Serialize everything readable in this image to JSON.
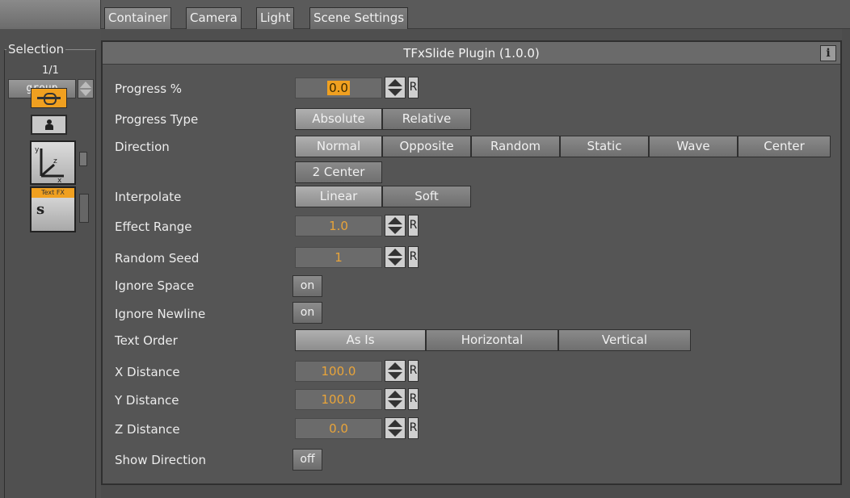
{
  "tabs": [
    "Container",
    "Camera",
    "Light",
    "Scene Settings"
  ],
  "selection": {
    "label": "Selection",
    "count": "1/1",
    "group_value": "group",
    "text_fx_badge": "Text FX",
    "text_fx_glyph": "s"
  },
  "icons": {
    "link": "link-icon",
    "person": "person-icon",
    "axis": "axis-transform-icon",
    "textfx": "text-fx-slide-icon",
    "info": "info-icon"
  },
  "panel": {
    "title": "TFxSlide Plugin (1.0.0)",
    "info_label": "i"
  },
  "fields": {
    "progress": {
      "label": "Progress %",
      "value": "0.0"
    },
    "progress_type": {
      "label": "Progress Type",
      "options": [
        "Absolute",
        "Relative"
      ],
      "selected": "Absolute"
    },
    "direction": {
      "label": "Direction",
      "options": [
        "Normal",
        "Opposite",
        "Random",
        "Static",
        "Wave",
        "Center",
        "2 Center"
      ],
      "selected": "Normal"
    },
    "interpolate": {
      "label": "Interpolate",
      "options": [
        "Linear",
        "Soft"
      ],
      "selected": "Linear"
    },
    "effect_range": {
      "label": "Effect Range",
      "value": "1.0"
    },
    "random_seed": {
      "label": "Random Seed",
      "value": "1"
    },
    "ignore_space": {
      "label": "Ignore Space",
      "value": "on"
    },
    "ignore_newline": {
      "label": "Ignore Newline",
      "value": "on"
    },
    "text_order": {
      "label": "Text Order",
      "options": [
        "As Is",
        "Horizontal",
        "Vertical"
      ],
      "selected": "As Is"
    },
    "x_distance": {
      "label": "X Distance",
      "value": "100.0"
    },
    "y_distance": {
      "label": "Y Distance",
      "value": "100.0"
    },
    "z_distance": {
      "label": "Z Distance",
      "value": "0.0"
    },
    "show_direction": {
      "label": "Show Direction",
      "value": "off"
    }
  },
  "reset_label": "R",
  "colors": {
    "background": "#4f4f4f",
    "value_text": "#e8a43a",
    "accent": "#f0a020"
  }
}
